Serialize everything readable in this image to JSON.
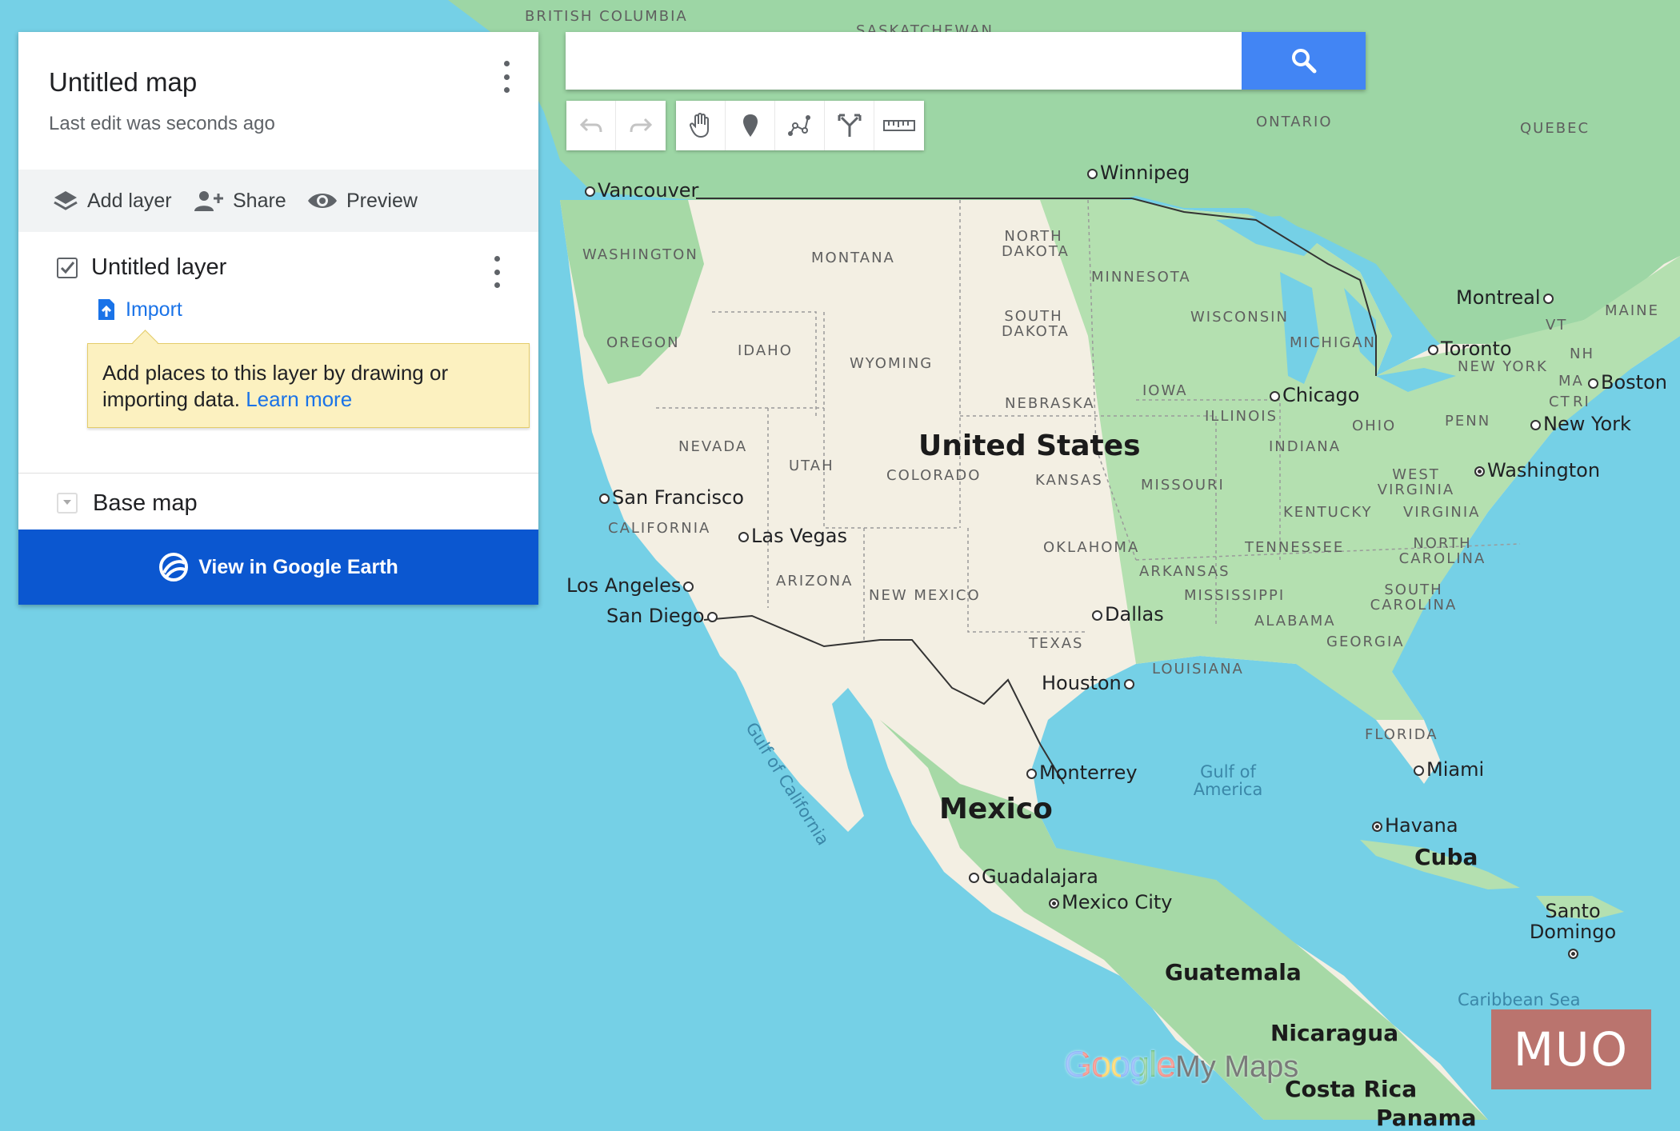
{
  "panel": {
    "title": "Untitled map",
    "subtitle": "Last edit was seconds ago",
    "actions": {
      "add_layer": "Add layer",
      "share": "Share",
      "preview": "Preview"
    },
    "layer": {
      "name": "Untitled layer",
      "checked": true,
      "import_label": "Import"
    },
    "tooltip": {
      "text": "Add places to this layer by drawing or importing data.",
      "link": "Learn more"
    },
    "base_map": "Base map",
    "earth_button": "View in Google Earth"
  },
  "search": {
    "value": "",
    "placeholder": ""
  },
  "toolbar": {
    "tools": [
      "undo-icon",
      "redo-icon",
      "hand-icon",
      "marker-icon",
      "draw-line-icon",
      "directions-icon",
      "ruler-icon"
    ]
  },
  "map": {
    "countries": [
      "United States",
      "Mexico",
      "Cuba",
      "Guatemala",
      "Nicaragua",
      "Costa Rica",
      "Panama"
    ],
    "provinces": [
      "BRITISH COLUMBIA",
      "SASKATCHEWAN",
      "ONTARIO",
      "QUEBEC"
    ],
    "states": [
      "WASHINGTON",
      "MONTANA",
      "NORTH DAKOTA",
      "MINNESOTA",
      "OREGON",
      "IDAHO",
      "SOUTH DAKOTA",
      "WYOMING",
      "WISCONSIN",
      "MICHIGAN",
      "VT",
      "MAINE",
      "NH",
      "NEW YORK",
      "MA",
      "CT",
      "RI",
      "NEBRASKA",
      "IOWA",
      "ILLINOIS",
      "OHIO",
      "PENN",
      "NEVADA",
      "UTAH",
      "COLORADO",
      "KANSAS",
      "MISSOURI",
      "INDIANA",
      "WEST VIRGINIA",
      "KENTUCKY",
      "VIRGINIA",
      "CALIFORNIA",
      "OKLAHOMA",
      "ARKANSAS",
      "TENNESSEE",
      "NORTH CAROLINA",
      "ARIZONA",
      "NEW MEXICO",
      "MISSISSIPPI",
      "ALABAMA",
      "SOUTH CAROLINA",
      "GEORGIA",
      "TEXAS",
      "LOUISIANA",
      "FLORIDA"
    ],
    "cities": [
      "Vancouver",
      "Winnipeg",
      "Montreal",
      "Toronto",
      "Boston",
      "Chicago",
      "New York",
      "Washington",
      "San Francisco",
      "Las Vegas",
      "Los Angeles",
      "San Diego",
      "Dallas",
      "Houston",
      "Monterrey",
      "Miami",
      "Havana",
      "Guadalajara",
      "Mexico City",
      "Santo Domingo"
    ],
    "water": [
      "Gulf of California",
      "Gulf of America",
      "Caribbean Sea"
    ]
  },
  "branding": {
    "logo_google": "Google",
    "logo_product": "My Maps",
    "watermark": "MUO"
  },
  "colors": {
    "water": "#75d0e6",
    "land": "#f3efe3",
    "vegetation": "#9fd8a8",
    "accent": "#0b57d0",
    "search_button": "#4285f4",
    "tooltip": "#fcf1c0"
  }
}
